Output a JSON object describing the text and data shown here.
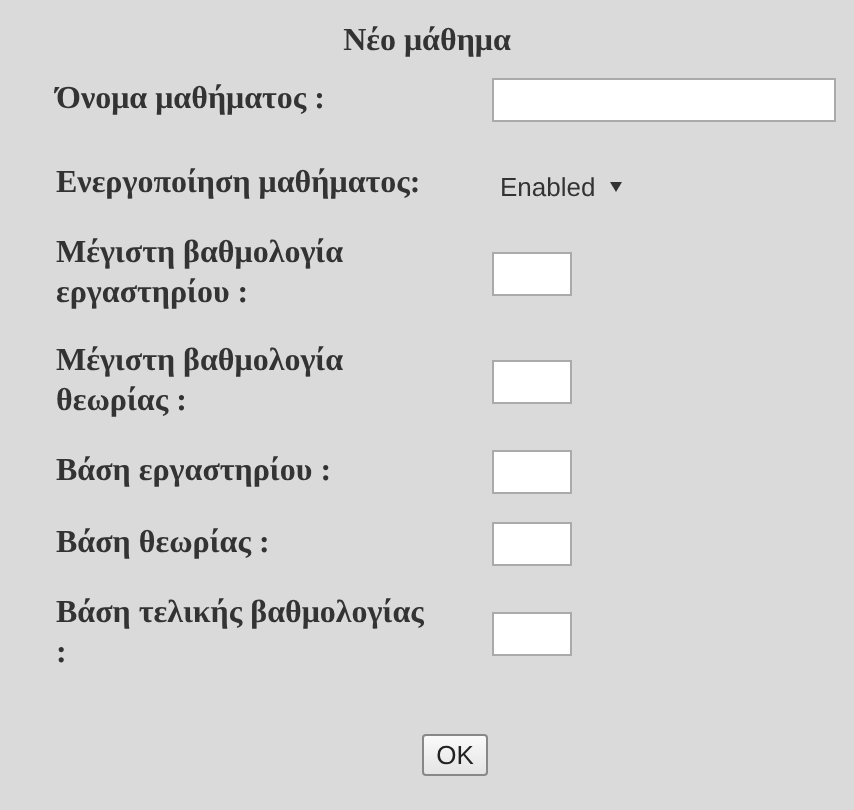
{
  "form": {
    "title": "Νέο μάθημα",
    "fields": [
      {
        "kind": "text",
        "label": "Όνομα μαθήματος :"
      },
      {
        "kind": "select",
        "label": "Ενεργοποίηση μαθήματος:",
        "value": "Enabled"
      },
      {
        "kind": "number",
        "label": "Μέγιστη βαθμολογία εργαστηρίου :"
      },
      {
        "kind": "number",
        "label": "Μέγιστη βαθμολογία θεωρίας :"
      },
      {
        "kind": "number",
        "label": "Βάση εργαστηρίου :"
      },
      {
        "kind": "number",
        "label": "Βάση θεωρίας :"
      },
      {
        "kind": "number",
        "label": "Βάση τελικής βαθμολογίας :"
      }
    ],
    "submit": "OK"
  }
}
